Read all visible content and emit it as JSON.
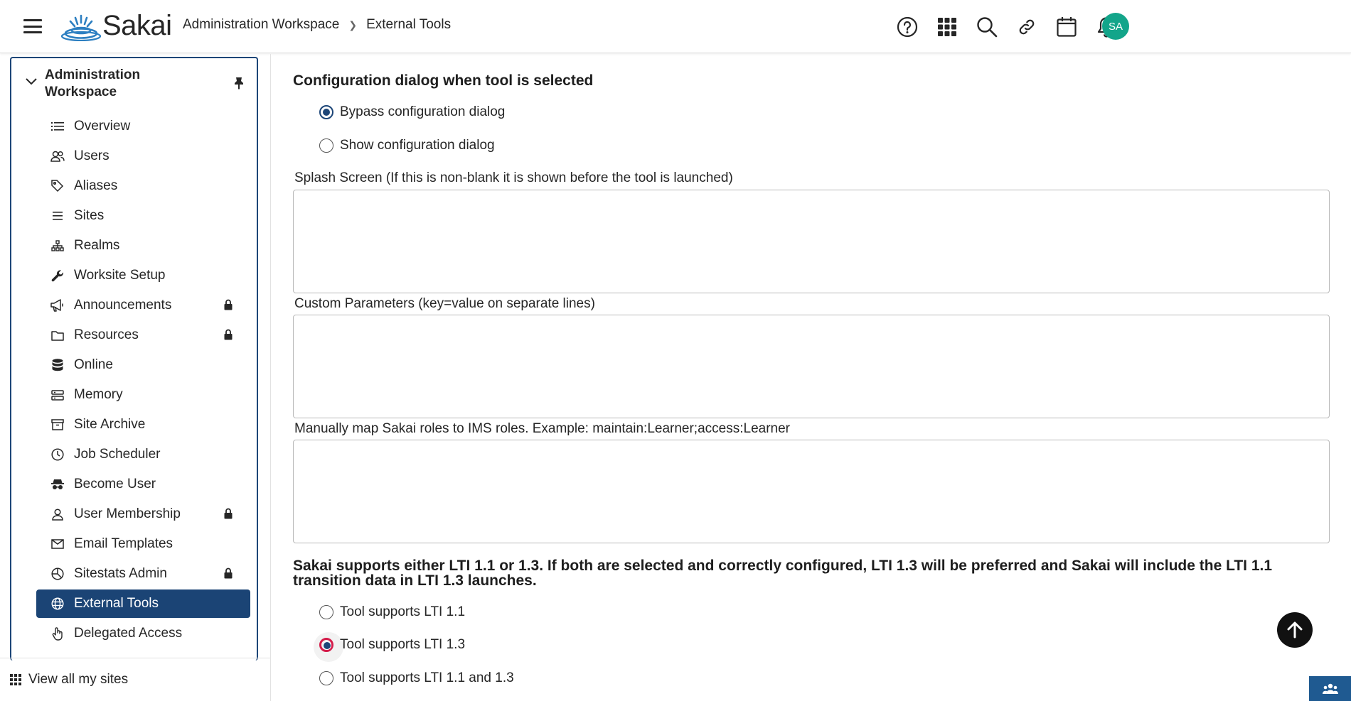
{
  "header": {
    "logo_text": "Sakai",
    "breadcrumb": {
      "workspace": "Administration Workspace",
      "tool": "External Tools"
    },
    "icons": [
      "help-icon",
      "apps-grid-icon",
      "search-icon",
      "link-icon",
      "calendar-icon",
      "bell-icon"
    ],
    "avatar_initials": "SA",
    "avatar_color": "#13a58a"
  },
  "sidebar": {
    "site_title": "Administration Workspace",
    "items": [
      {
        "label": "Overview",
        "icon": "list-icon",
        "locked": false
      },
      {
        "label": "Users",
        "icon": "users-icon",
        "locked": false
      },
      {
        "label": "Aliases",
        "icon": "tags-icon",
        "locked": false
      },
      {
        "label": "Sites",
        "icon": "lines-icon",
        "locked": false
      },
      {
        "label": "Realms",
        "icon": "hierarchy-icon",
        "locked": false
      },
      {
        "label": "Worksite Setup",
        "icon": "wrench-icon",
        "locked": false
      },
      {
        "label": "Announcements",
        "icon": "megaphone-icon",
        "locked": true
      },
      {
        "label": "Resources",
        "icon": "folder-icon",
        "locked": true
      },
      {
        "label": "Online",
        "icon": "database-icon",
        "locked": false
      },
      {
        "label": "Memory",
        "icon": "memory-icon",
        "locked": false
      },
      {
        "label": "Site Archive",
        "icon": "archive-icon",
        "locked": false
      },
      {
        "label": "Job Scheduler",
        "icon": "clock-icon",
        "locked": false
      },
      {
        "label": "Become User",
        "icon": "spy-icon",
        "locked": false
      },
      {
        "label": "User Membership",
        "icon": "user-icon",
        "locked": true
      },
      {
        "label": "Email Templates",
        "icon": "envelope-icon",
        "locked": false
      },
      {
        "label": "Sitestats Admin",
        "icon": "pie-chart-icon",
        "locked": true
      },
      {
        "label": "External Tools",
        "icon": "globe-icon",
        "locked": false,
        "active": true
      },
      {
        "label": "Delegated Access",
        "icon": "hand-pointer-icon",
        "locked": false
      }
    ],
    "view_all": "View all my sites",
    "active_color": "#1b4475"
  },
  "main": {
    "config_title": "Configuration dialog when tool is selected",
    "config_options": [
      {
        "label": "Bypass configuration dialog",
        "checked": true
      },
      {
        "label": "Show configuration dialog",
        "checked": false
      }
    ],
    "splash_label": "Splash Screen (If this is non-blank it is shown before the tool is launched)",
    "splash_value": "",
    "custom_label": "Custom Parameters (key=value on separate lines)",
    "custom_value": "",
    "roles_label": "Manually map Sakai roles to IMS roles. Example: maintain:Learner;access:Learner",
    "roles_value": "",
    "lti_note": "Sakai supports either LTI 1.1 or 1.3. If both are selected and correctly configured, LTI 1.3 will be preferred and Sakai will include the LTI 1.1 transition data in LTI 1.3 launches.",
    "lti_options": [
      {
        "label": "Tool supports LTI 1.1",
        "checked": false
      },
      {
        "label": "Tool supports LTI 1.3",
        "checked": true,
        "focused": true
      },
      {
        "label": "Tool supports LTI 1.1 and 1.3",
        "checked": false
      }
    ],
    "focus_color": "#e01e4e"
  },
  "floating": {
    "scroll_top_icon": "arrow-up-icon",
    "people_icon": "users-icon"
  }
}
